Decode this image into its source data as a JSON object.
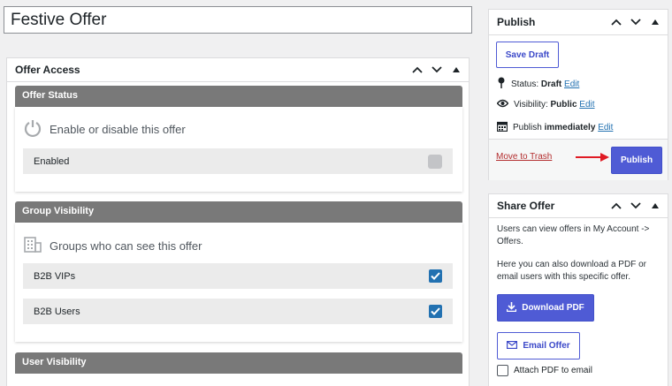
{
  "post": {
    "title": "Festive Offer"
  },
  "offer_access": {
    "title": "Offer Access",
    "offer_status": {
      "bar": "Offer Status",
      "heading": "Enable or disable this offer",
      "enabled_label": "Enabled"
    },
    "group_visibility": {
      "bar": "Group Visibility",
      "heading": "Groups who can see this offer",
      "groups": [
        {
          "label": "B2B VIPs",
          "checked": true
        },
        {
          "label": "B2B Users",
          "checked": true
        }
      ]
    },
    "user_visibility": {
      "bar": "User Visibility"
    }
  },
  "publish": {
    "title": "Publish",
    "save_draft": "Save Draft",
    "status_label": "Status:",
    "status_value": "Draft",
    "visibility_label": "Visibility:",
    "visibility_value": "Public",
    "publish_label": "Publish",
    "publish_value": "immediately",
    "edit": "Edit",
    "move_to_trash": "Move to Trash",
    "publish_button": "Publish"
  },
  "share_offer": {
    "title": "Share Offer",
    "text1": "Users can view offers in My Account -> Offers.",
    "text2": "Here you can also download a PDF or email users with this specific offer.",
    "download_pdf": "Download PDF",
    "email_offer": "Email Offer",
    "attach_pdf": "Attach PDF to email"
  },
  "colors": {
    "accent": "#4f5bd5",
    "section_bar": "#797979",
    "link": "#2271b1",
    "trash": "#b32d2e",
    "arrow": "#e01b24"
  }
}
